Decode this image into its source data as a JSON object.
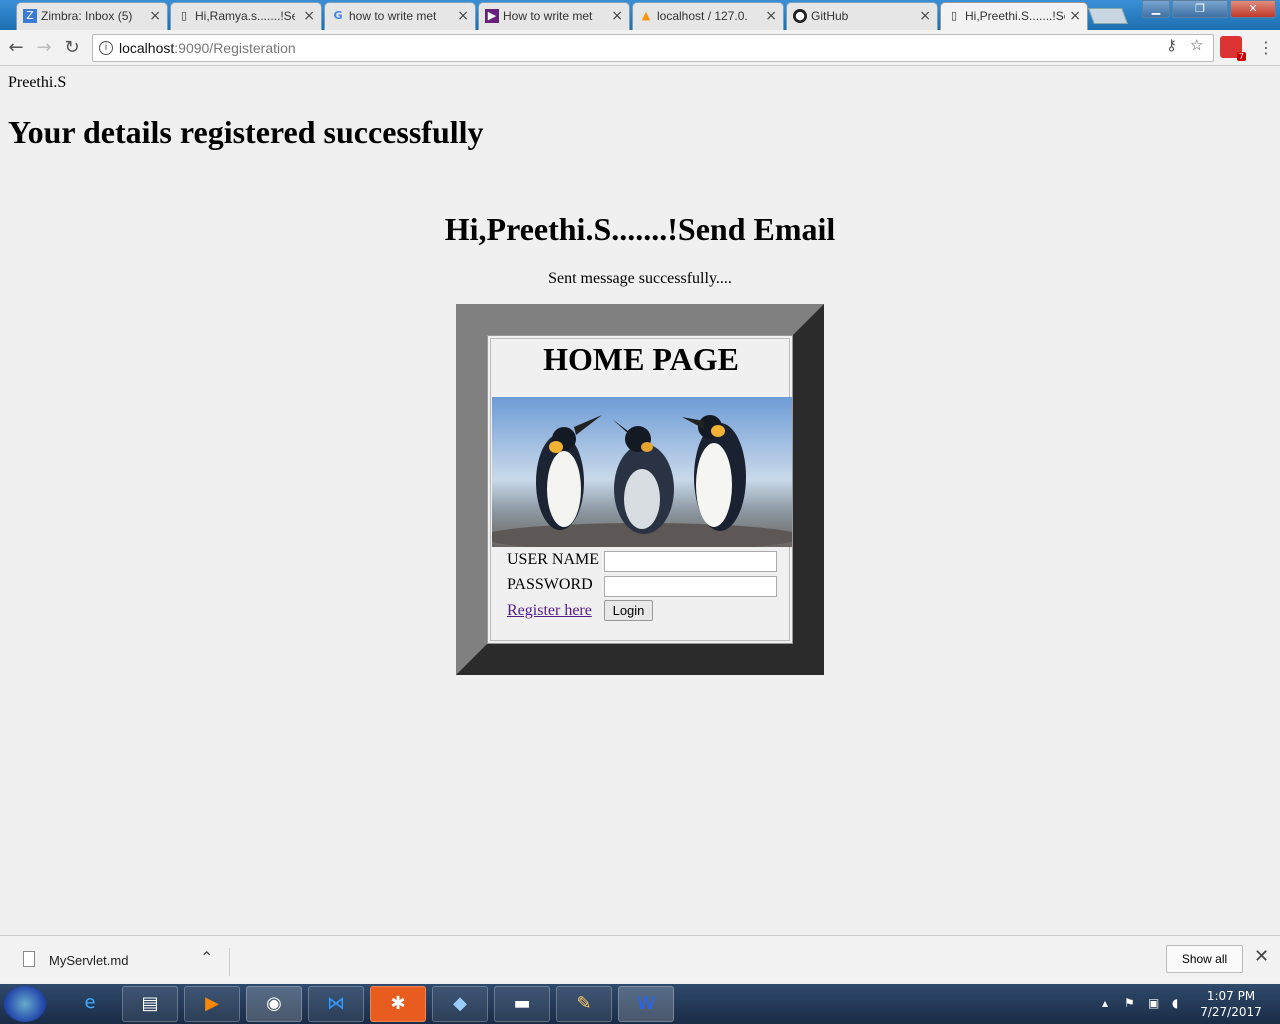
{
  "browser": {
    "tabs": [
      {
        "label": "Zimbra: Inbox (5)",
        "icon": "zimbra-icon"
      },
      {
        "label": "Hi,Ramya.s.......!Se",
        "icon": "page-icon"
      },
      {
        "label": "how to write met",
        "icon": "google-icon"
      },
      {
        "label": "How to write met",
        "icon": "visualstudio-icon"
      },
      {
        "label": "localhost / 127.0.",
        "icon": "phpmyadmin-icon"
      },
      {
        "label": "GitHub",
        "icon": "github-icon"
      },
      {
        "label": "Hi,Preethi.S.......!Se",
        "icon": "page-icon",
        "active": true
      }
    ],
    "address": {
      "host": "localhost",
      "path": ":9090/Registeration"
    },
    "extension_badge": "7"
  },
  "page": {
    "username": "Preethi.S",
    "heading": "Your details registered successfully",
    "greeting": "Hi,Preethi.S.......!Send Email",
    "status": "Sent message successfully....",
    "home": {
      "title": "HOME PAGE",
      "username_label": "USER NAME",
      "password_label": "PASSWORD",
      "register_link": "Register here",
      "login_button": "Login",
      "username_value": "",
      "password_value": ""
    }
  },
  "downloads": {
    "file": "MyServlet.md",
    "show_all": "Show all"
  },
  "taskbar": {
    "time": "1:07 PM",
    "date": "7/27/2017"
  },
  "colors": {
    "frame_light": "#808080",
    "frame_dark": "#2b2b2b",
    "link": "#551a8b"
  }
}
